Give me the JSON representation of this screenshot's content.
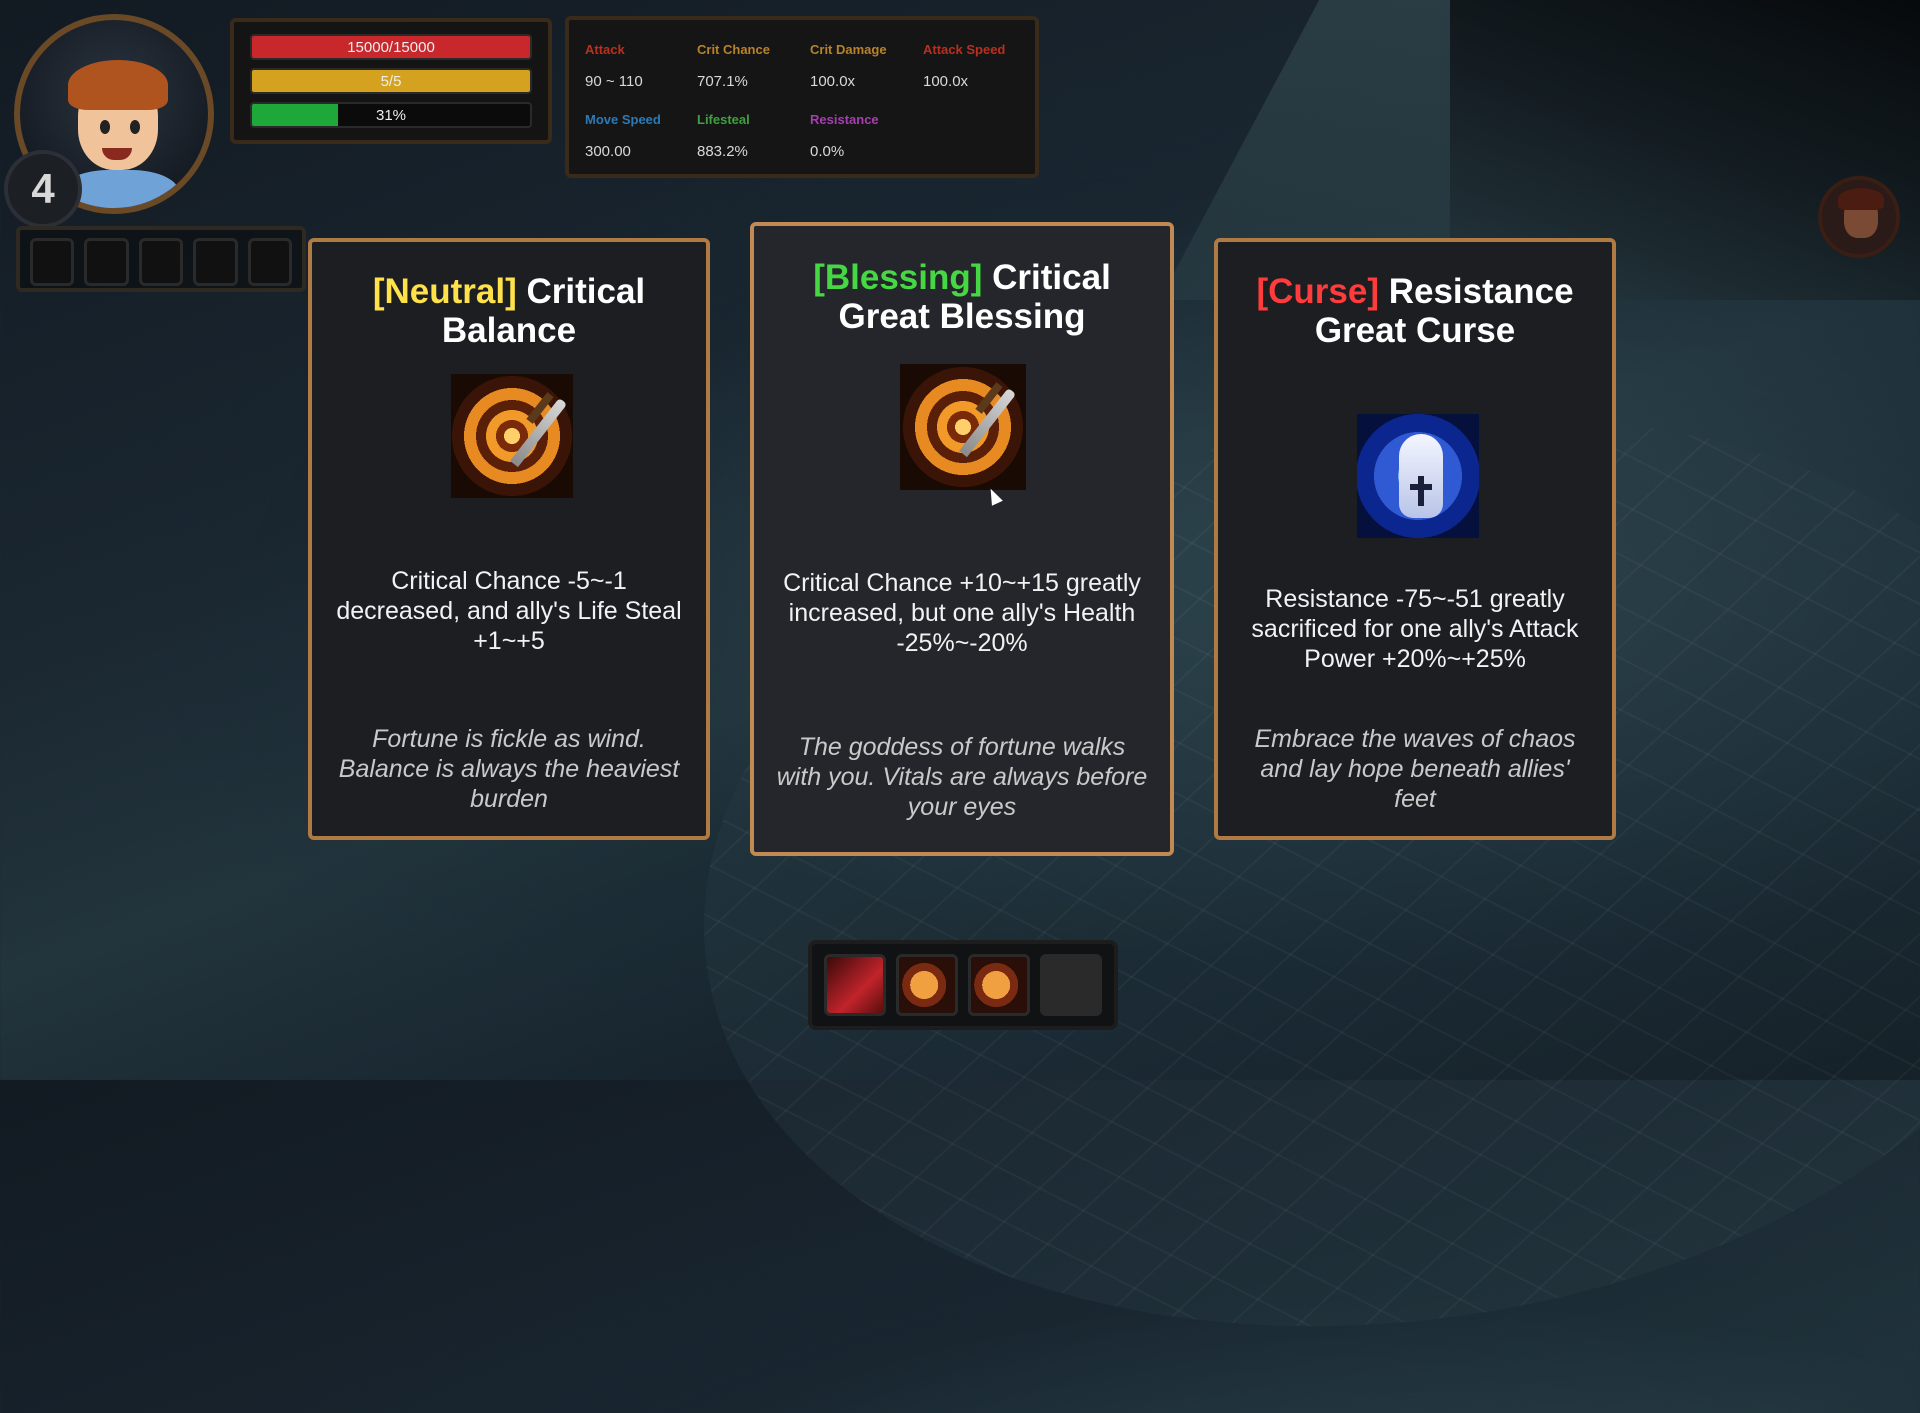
{
  "player": {
    "level": "4",
    "health_text": "15000/15000",
    "health_fraction": 1.0,
    "mana_text": "5/5",
    "mana_fraction": 1.0,
    "exp_text": "31%",
    "exp_fraction": 0.31
  },
  "stats": [
    {
      "label": "Attack",
      "value": "90 ~ 110",
      "color": "#b8301f"
    },
    {
      "label": "Crit Chance",
      "value": "707.1%",
      "color": "#b8822a"
    },
    {
      "label": "Crit Damage",
      "value": "100.0x",
      "color": "#b8822a"
    },
    {
      "label": "Attack Speed",
      "value": "100.0x",
      "color": "#b8301f"
    },
    {
      "label": "Move Speed",
      "value": "300.00",
      "color": "#2a7ab8"
    },
    {
      "label": "Lifesteal",
      "value": "883.2%",
      "color": "#3ea040"
    },
    {
      "label": "Resistance",
      "value": "0.0%",
      "color": "#a53eb0"
    }
  ],
  "cards": [
    {
      "tag": "[Neutral]",
      "tag_color": "#ffe14a",
      "title": "Critical Balance",
      "icon": "critical-target-dagger-icon",
      "description": "Critical Chance -5~-1 decreased, and ally's Life Steal +1~+5",
      "flavor": "Fortune is fickle as wind. Balance is always the heaviest burden"
    },
    {
      "tag": "[Blessing]",
      "tag_color": "#45d843",
      "title": "Critical Great Blessing",
      "icon": "critical-target-dagger-icon",
      "description": "Critical Chance +10~+15 greatly increased, but one ally's Health -25%~-20%",
      "flavor": "The goddess of fortune walks with you. Vitals are always before your eyes"
    },
    {
      "tag": "[Curse]",
      "tag_color": "#ff3b3b",
      "title": "Resistance Great Curse",
      "icon": "holy-hand-shield-icon",
      "description": "Resistance -75~-51 greatly sacrificed for one ally's Attack Power +20%~+25%",
      "flavor": "Embrace the waves of chaos and lay hope beneath allies' feet"
    }
  ],
  "colors": {
    "card_border": "#b07a45",
    "health": "#c8282c",
    "mana": "#d4a21e",
    "exp": "#1fa83a"
  }
}
